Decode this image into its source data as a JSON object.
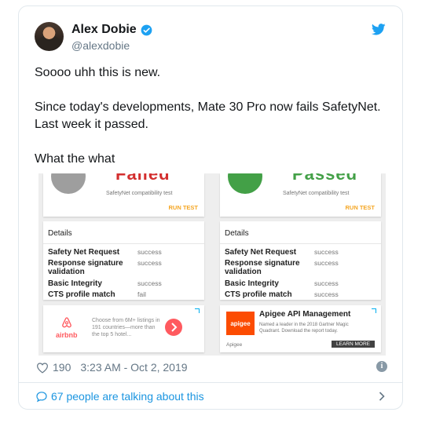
{
  "author": {
    "name": "Alex Dobie",
    "handle": "@alexdobie"
  },
  "tweet": {
    "lines": [
      "Soooo uhh this is new.",
      "Since today's developments, Mate 30 Pro now fails SafetyNet.",
      "Last week it passed.",
      "What the what"
    ]
  },
  "media": {
    "left": {
      "status": "Failed",
      "status_color": "#d32f2f",
      "compat_text": "SafetyNet compatibility test",
      "run_test": "RUN TEST",
      "details_title": "Details",
      "rows": [
        {
          "label": "Safety Net Request",
          "value": "success"
        },
        {
          "label": "Response signature validation",
          "value": "success"
        },
        {
          "label": "Basic Integrity",
          "value": "success"
        },
        {
          "label": "CTS profile match",
          "value": "fail"
        }
      ],
      "ad": {
        "brand": "airbnb",
        "text": "Choose from 6M+ listings in 191 countries—more than the top 5 hotel..."
      }
    },
    "right": {
      "status": "Passed",
      "status_color": "#43a047",
      "compat_text": "SafetyNet compatibility test",
      "run_test": "RUN TEST",
      "details_title": "Details",
      "rows": [
        {
          "label": "Safety Net Request",
          "value": "success"
        },
        {
          "label": "Response signature validation",
          "value": "success"
        },
        {
          "label": "Basic Integrity",
          "value": "success"
        },
        {
          "label": "CTS profile match",
          "value": "success"
        }
      ],
      "ad": {
        "logo": "apigee",
        "title": "Apigee API Management",
        "desc": "Named a leader in the 2018 Gartner Magic Quadrant. Download the report today.",
        "source": "Apigee",
        "cta": "LEARN MORE"
      }
    }
  },
  "meta": {
    "likes": "190",
    "timestamp": "3:23 AM - Oct 2, 2019"
  },
  "footer": {
    "talking": "67 people are talking about this"
  },
  "colors": {
    "twitter_blue": "#1da1f2",
    "link_blue": "#1b95e0",
    "muted": "#657786"
  },
  "icons": [
    "verified-icon",
    "twitter-bird-icon",
    "heart-icon",
    "info-icon",
    "comment-bubble-icon",
    "chevron-right-icon"
  ]
}
